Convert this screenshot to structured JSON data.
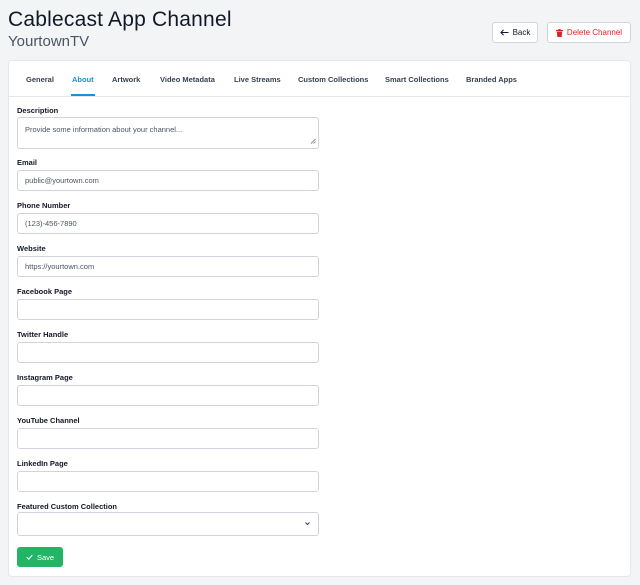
{
  "header": {
    "title": "Cablecast App Channel",
    "subtitle": "YourtownTV"
  },
  "actions": {
    "back_label": "Back",
    "delete_label": "Delete Channel"
  },
  "tabs": [
    {
      "label": "General"
    },
    {
      "label": "About",
      "active": true
    },
    {
      "label": "Artwork"
    },
    {
      "label": "Video Metadata"
    },
    {
      "label": "Live Streams"
    },
    {
      "label": "Custom Collections"
    },
    {
      "label": "Smart Collections"
    },
    {
      "label": "Branded Apps"
    }
  ],
  "form": {
    "description": {
      "label": "Description",
      "placeholder": "Provide some information about your channel..."
    },
    "email": {
      "label": "Email",
      "placeholder": "public@yourtown.com"
    },
    "phone": {
      "label": "Phone Number",
      "placeholder": "(123)-456-7890"
    },
    "website": {
      "label": "Website",
      "placeholder": "https://yourtown.com"
    },
    "facebook": {
      "label": "Facebook Page",
      "value": ""
    },
    "twitter": {
      "label": "Twitter Handle",
      "value": ""
    },
    "instagram": {
      "label": "Instagram Page",
      "value": ""
    },
    "youtube": {
      "label": "YouTube Channel",
      "value": ""
    },
    "linkedin": {
      "label": "LinkedIn Page",
      "value": ""
    },
    "featured": {
      "label": "Featured Custom Collection",
      "value": ""
    },
    "save_label": "Save"
  },
  "colors": {
    "accent": "#1c8fd6",
    "danger": "#e02424",
    "success": "#22b566"
  }
}
